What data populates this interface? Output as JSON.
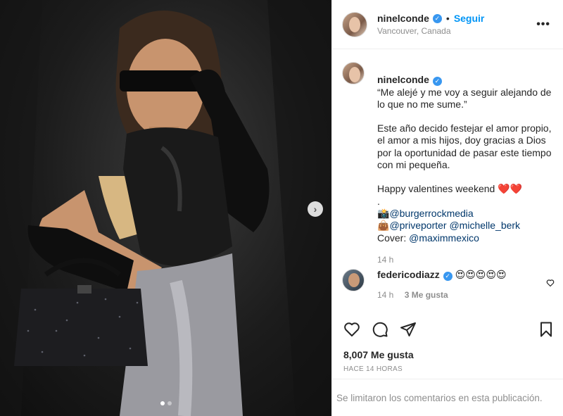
{
  "post": {
    "username": "ninelconde",
    "follow_label": "Seguir",
    "separator": "•",
    "location": "Vancouver, Canada",
    "more_label": "•••"
  },
  "caption": {
    "username": "ninelconde",
    "lines": [
      "“Me alejé y me voy a seguir alejando de lo que no me sume.”",
      "Este año decido festejar el amor propio, el amor a mis hijos, doy gracias a Dios por la oportunidad de pasar este tiempo con mi pequeña.",
      "Happy valentines weekend ❤️❤️",
      "."
    ],
    "credit_photo_icon": "📸",
    "credit_photo_tag": "@burgerrockmedia",
    "credit_bag_icon": "👜",
    "credit_bag_tag1": "@priveporter",
    "credit_bag_tag2": "@michelle_berk",
    "cover_label": "Cover: ",
    "cover_tag": "@maximmexico",
    "time": "14 h"
  },
  "comment": {
    "username": "federicodiazz",
    "text": "😍😍😍😍😍",
    "time": "14 h",
    "likes": "3 Me gusta"
  },
  "likes_count": "8,007 Me gusta",
  "posted_ago": "HACE 14 HORAS",
  "comments_limited": "Se limitaron los comentarios en esta publicación.",
  "carousel": {
    "current": 1,
    "total": 2
  },
  "colors": {
    "link": "#0095f6",
    "tag": "#00376b",
    "muted": "#8e8e8e",
    "verified": "#3897f0"
  }
}
